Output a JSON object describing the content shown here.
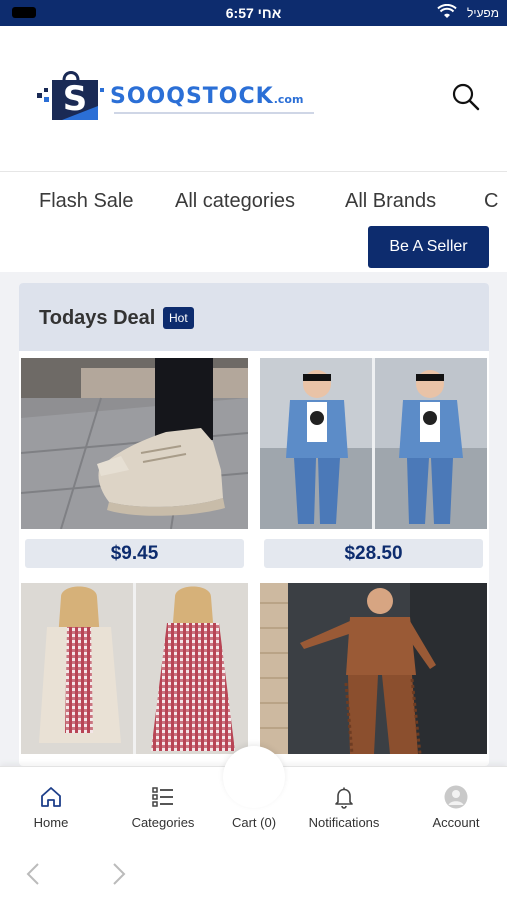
{
  "status_bar": {
    "time": "6:57 אחי",
    "carrier": "מפעיל"
  },
  "header": {
    "brand_name": "SOOQSTOCK",
    "brand_suffix": ".com",
    "logo_letter": "S",
    "search_icon": "search-icon"
  },
  "nav": {
    "tabs": [
      "Flash Sale",
      "All categories",
      "All Brands",
      "C"
    ],
    "seller_button": "Be A Seller"
  },
  "deal": {
    "title": "Todays Deal",
    "badge": "Hot",
    "products": [
      {
        "price": "$9.45"
      },
      {
        "price": "$28.50"
      },
      {
        "price": ""
      },
      {
        "price": ""
      }
    ]
  },
  "tabbar": {
    "tabs": [
      {
        "label": "Home",
        "icon": "home-icon"
      },
      {
        "label": "Categories",
        "icon": "list-icon"
      },
      {
        "label": "Cart (0)",
        "icon": "cart-icon"
      },
      {
        "label": "Notifications",
        "icon": "bell-icon"
      },
      {
        "label": "Account",
        "icon": "user-avatar-icon"
      }
    ]
  },
  "colors": {
    "primary": "#0d2c6e",
    "brand_blue": "#2b6fd6",
    "deal_header_bg": "#dde2ec",
    "price_bg": "#e4e8ef"
  }
}
